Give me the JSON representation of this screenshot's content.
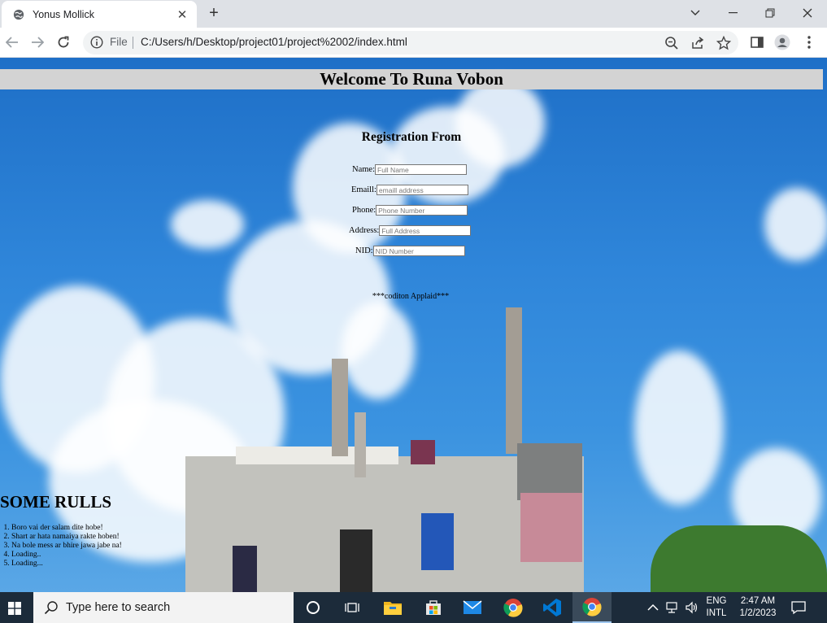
{
  "browser": {
    "tab_title": "Yonus Mollick",
    "tab_close": "✕",
    "new_tab": "+",
    "address_scheme": "File",
    "address_url": "C:/Users/h/Desktop/project01/project%2002/index.html"
  },
  "page": {
    "welcome": "Welcome To Runa Vobon",
    "registration_title": "Registration From",
    "fields": [
      {
        "label": "Name:",
        "placeholder": "Full Name"
      },
      {
        "label": "Emaill:",
        "placeholder": "emaill address"
      },
      {
        "label": "Phone:",
        "placeholder": "Phone Number"
      },
      {
        "label": "Address:",
        "placeholder": "Full Address"
      },
      {
        "label": "NID:",
        "placeholder": "NID Number"
      }
    ],
    "condition": "***coditon Applaid***",
    "rules_title": "SOME RULLS",
    "rules": [
      "Boro vai der salam dite hobe!",
      "Shart ar hata namaiya rakte hoben!",
      "Na bole mess ar bhire jawa jabe na!",
      "Loading..",
      "Loading..."
    ]
  },
  "taskbar": {
    "search_placeholder": "Type here to search",
    "lang_top": "ENG",
    "lang_bottom": "INTL",
    "time": "2:47 AM",
    "date": "1/2/2023"
  },
  "colors": {
    "taskbar_bg": "#1c2b3a",
    "welcome_bg": "#d3d3d3",
    "sky": "#2f86da"
  }
}
